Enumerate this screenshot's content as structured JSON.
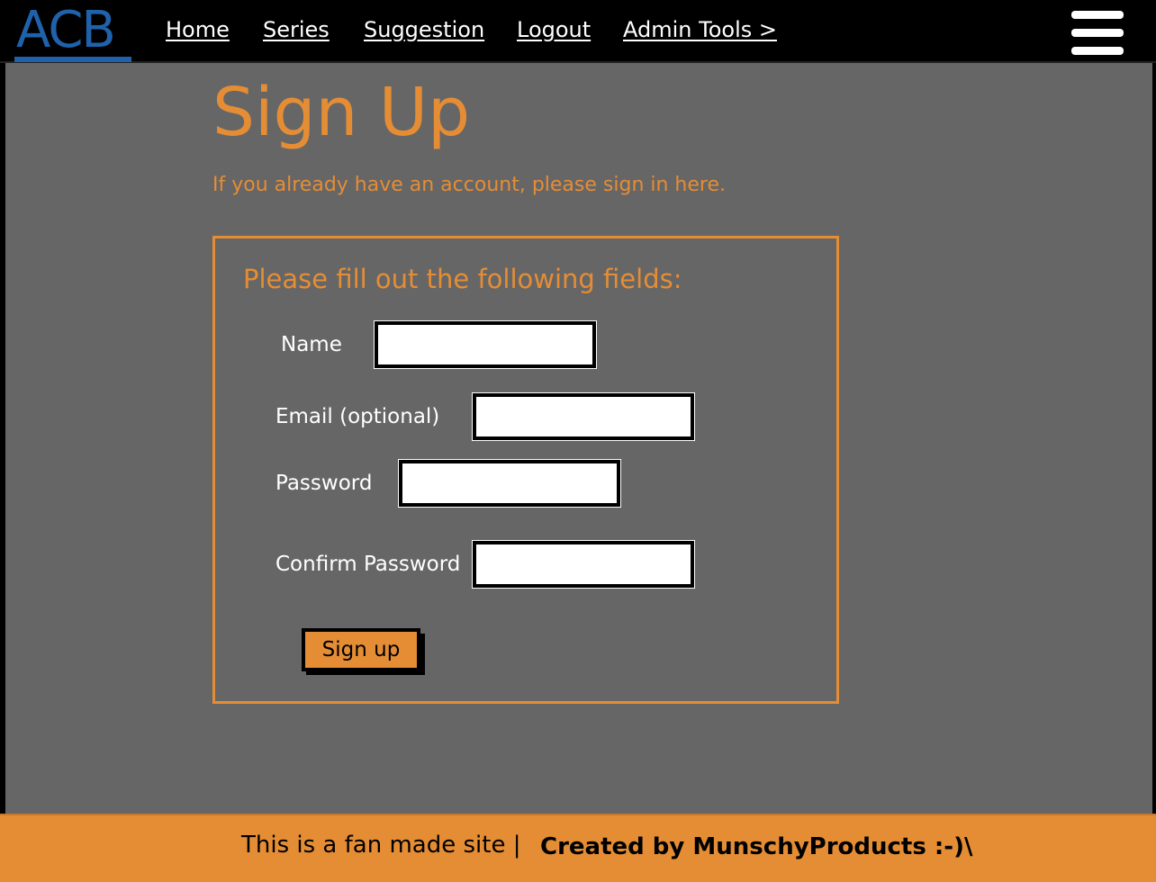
{
  "header": {
    "logo": "ACB",
    "nav": [
      "Home",
      "Series",
      "Suggestion",
      "Logout",
      "Admin Tools >"
    ]
  },
  "main": {
    "title": "Sign Up",
    "signin_note": "If you already have an account, please sign in here.",
    "form": {
      "heading": "Please fill out the following fields:",
      "fields": [
        {
          "label": "Name",
          "value": ""
        },
        {
          "label": "Email (optional)",
          "value": ""
        },
        {
          "label": "Password",
          "value": ""
        },
        {
          "label": "Confirm Password",
          "value": ""
        }
      ],
      "submit_label": "Sign up"
    }
  },
  "footer": {
    "text": "This is a fan made site |",
    "credit": "Created by MunschyProducts :-)\\"
  },
  "colors": {
    "accent": "#e58d35",
    "background": "#666666",
    "logo": "#1f62ab",
    "header": "#000000"
  }
}
